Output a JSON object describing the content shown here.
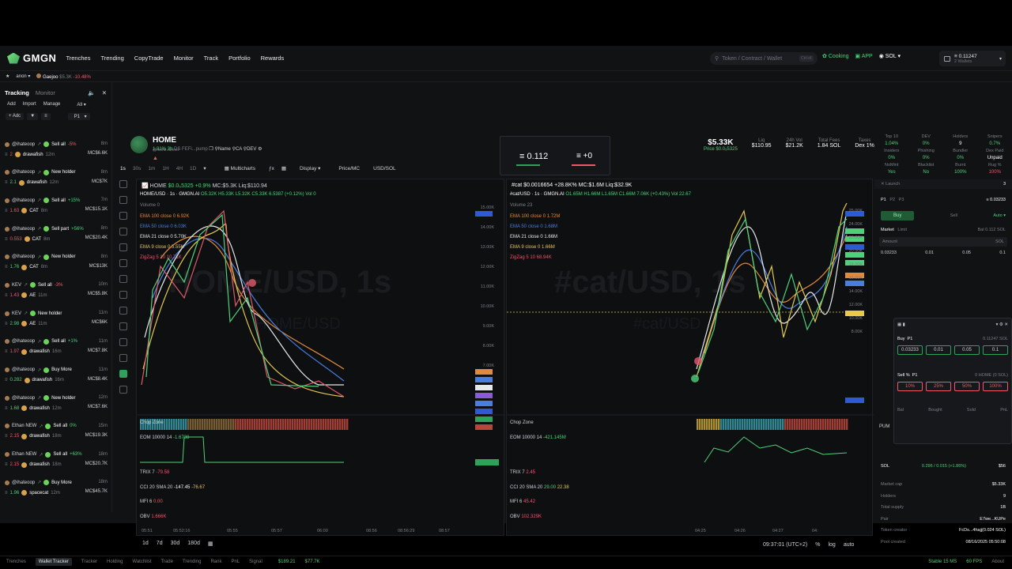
{
  "nav": {
    "brand": "GMGN",
    "links": [
      "Trenches",
      "Trending",
      "CopyTrade",
      "Monitor",
      "Track",
      "Portfolio",
      "Rewards"
    ],
    "search_placeholder": "Token / Contract / Wallet",
    "search_kbd": "Ctrl+K",
    "cooking": "Cooking",
    "app": "APP",
    "chain": "SOL",
    "wallet_balance": "0.11247",
    "wallet_count": "2 Wallets"
  },
  "subbar": {
    "account": "anon",
    "ticker_name": "Gaejoo",
    "ticker_mc": "$5.3K",
    "ticker_change": "-10.48%"
  },
  "left": {
    "tab_active": "Tracking",
    "tab_other": "Monitor",
    "actions": [
      "Add",
      "Import",
      "Manage"
    ],
    "filter_all": "All",
    "filter_add": "+ Adc",
    "filter_p1": "P1",
    "feed": [
      {
        "user": "@ihateoop",
        "action": "Sell all",
        "pct": "-5%",
        "time": "8m",
        "amt": "2",
        "token": "drawafish",
        "age": "12m",
        "mc": "MC$6.6K"
      },
      {
        "user": "@ihateoop",
        "action": "New holder",
        "pct": "",
        "time": "8m",
        "amt": "2.1",
        "token": "drawafish",
        "age": "12m",
        "mc": "MC$7K"
      },
      {
        "user": "@ihateoop",
        "action": "Sell all",
        "pct": "+15%",
        "time": "7m",
        "amt": "1.63",
        "token": "CAT",
        "age": "8m",
        "mc": "MC$15.1K"
      },
      {
        "user": "@ihateoop",
        "action": "Sell part",
        "pct": "+56%",
        "time": "8m",
        "amt": "0.553",
        "token": "CAT",
        "age": "8m",
        "mc": "MC$20.4K"
      },
      {
        "user": "@ihateoop",
        "action": "New holder",
        "pct": "",
        "time": "8m",
        "amt": "1.76",
        "token": "CAT",
        "age": "8m",
        "mc": "MC$13K"
      },
      {
        "user": "KEV",
        "action": "Sell all",
        "pct": "-3%",
        "time": "10m",
        "amt": "1.43",
        "token": "AE",
        "age": "11m",
        "mc": "MC$5.8K"
      },
      {
        "user": "KEV",
        "action": "New holder",
        "pct": "",
        "time": "11m",
        "amt": "2.98",
        "token": "AE",
        "age": "11m",
        "mc": "MC$6K"
      },
      {
        "user": "@ihateoop",
        "action": "Sell all",
        "pct": "+1%",
        "time": "11m",
        "amt": "1.97",
        "token": "drawafish",
        "age": "16m",
        "mc": "MC$7.8K"
      },
      {
        "user": "@ihateoop",
        "action": "Buy More",
        "pct": "",
        "time": "11m",
        "amt": "0.282",
        "token": "drawafish",
        "age": "16m",
        "mc": "MC$8.4K"
      },
      {
        "user": "@ihateoop",
        "action": "New holder",
        "pct": "",
        "time": "12m",
        "amt": "1.68",
        "token": "drawafish",
        "age": "12m",
        "mc": "MC$7.6K"
      },
      {
        "user": "Ethan NEW",
        "action": "Sell all",
        "pct": "0%",
        "time": "15m",
        "amt": "2.15",
        "token": "drawafish",
        "age": "18m",
        "mc": "MC$19.3K"
      },
      {
        "user": "Ethan NEW",
        "action": "Sell all",
        "pct": "+63%",
        "time": "18m",
        "amt": "2.15",
        "token": "drawafish",
        "age": "18m",
        "mc": "MC$20.7K"
      },
      {
        "user": "@ihateoop",
        "action": "Buy More",
        "pct": "",
        "time": "18m",
        "amt": "1.96",
        "token": "spacecat",
        "age": "12m",
        "mc": "MC$45.7K"
      }
    ]
  },
  "token": {
    "name": "HOME",
    "handle": "@home.runner",
    "change": "1.31%",
    "age": "3h",
    "pair": "DS FEFi...pump",
    "extras": [
      "Name",
      "CA",
      "DEV"
    ],
    "center_value": "0.112",
    "center_delta": "+0",
    "mc": "$5.33K",
    "price": "Price $0.0₅5325",
    "liq_label": "Liq",
    "liq": "$110.95",
    "vol_label": "24h Vol",
    "vol": "$21.2K",
    "fees_label": "Total Fees",
    "fees": "1.84 SOL",
    "taxes_label": "Taxes",
    "taxes": "Dex 1%"
  },
  "toolbar": {
    "intervals": [
      "1s",
      "30s",
      "1m",
      "1H",
      "4H",
      "1D"
    ],
    "multicharts": "Multicharts",
    "display": "Display",
    "price_mc": "Price/MC",
    "usd_sol": "USD/SOL"
  },
  "chart_left": {
    "title": "HOME/USD · 1s · GMGN.AI",
    "ohlc": "O5.32K H5.33K L5.32K C5.33K 6.5387 (+0.12%) Vol 0",
    "volume": "Volume 0",
    "watermark": "HOME/USD, 1s",
    "watermark_sub": "HOME/USD",
    "ema_lines": [
      "EMA 100 close 0  6.92K",
      "EMA 50 close 0  6.03K",
      "EMA 21 close 0  5.70K",
      "EMA 9 close 0  5.55K",
      "ZigZag 5 10  10.71K"
    ],
    "price_ticks": [
      "15.00K",
      "14.00K",
      "13.00K",
      "12.00K",
      "11.00K",
      "10.00K",
      "9.00K",
      "8.00K",
      "7.00K"
    ],
    "high_tag": "14.71K",
    "low_tag": "5.32K",
    "chop": "Chop Zone",
    "eom": "EOM 10000 14",
    "eom_val": "-1.6738",
    "trix": "TRIX 7",
    "trix_val": "-79.58",
    "cci": "CCI 20 SMA 20",
    "cci_val": "-147.45",
    "cci_val2": "-76.67",
    "mfi": "MFI 6",
    "mfi_val": "0.00",
    "obv": "OBV",
    "obv_val": "1.666K",
    "times": [
      "05:51",
      "05:52:16",
      "05:55",
      "05:57",
      "06:00",
      "08:56",
      "08:56:29",
      "08:57"
    ]
  },
  "chart_right": {
    "title": "#cat/USD · 1s · GMGN.AI",
    "pair_stats": "#cat $0.0016654 +28.8K%  MC:$1.6M  Liq:$32.9K",
    "ohlc": "O1.65M H1.66M L1.65M C1.66M 7.06K (+0.43%) Vol 22.67",
    "volume": "Volume 23",
    "watermark": "#cat/USD, 1s",
    "watermark_sub": "#cat/USD",
    "ema_lines": [
      "EMA 100 close 0  1.72M",
      "EMA 50 close 0  1.68M",
      "EMA 21 close 0  1.66M",
      "EMA 9 close 0  1.66M",
      "ZigZag 5 10  68.94K"
    ],
    "price_ticks": [
      "25.00K",
      "24.00K",
      "22.00K",
      "20.00K",
      "18.00K",
      "16.00K",
      "14.00K",
      "12.00K",
      "10.00K",
      "8.00K"
    ],
    "high_tag": "25.48K",
    "low_tag": "5.76K",
    "line_tag": "15.02K",
    "chop": "Chop Zone",
    "eom": "EOM 10000 14",
    "eom_val": "-421.145M",
    "trix": "TRIX 7",
    "trix_val": "2.45",
    "cci": "CCI 20 SMA 20",
    "cci_val": "29.00",
    "cci_val2": "22.38",
    "mfi": "MFI 6",
    "mfi_val": "45.42",
    "obv": "OBV",
    "obv_val": "102.329K",
    "times": [
      "04:25",
      "04:26",
      "04:27",
      "04:"
    ]
  },
  "bottom": {
    "ranges": [
      "1d",
      "7d",
      "30d",
      "180d"
    ],
    "clock": "09:37:01 (UTC+2)",
    "pct": "%",
    "log": "log",
    "auto": "auto"
  },
  "right": {
    "stats_labels": [
      "Top 10",
      "DEV",
      "Holders",
      "Snipers"
    ],
    "stats_values": [
      "1.04%",
      "0%",
      "9",
      "0.7%"
    ],
    "stats2_labels": [
      "Insiders",
      "Phishing",
      "Bundler",
      "Dex Paid"
    ],
    "stats2_values": [
      "0%",
      "0%",
      "0%",
      "Unpaid"
    ],
    "stats3_labels": [
      "NoMint",
      "Blacklist",
      "Burnt",
      "Rug %"
    ],
    "stats3_values": [
      "Yes",
      "No",
      "100%",
      "100%"
    ],
    "launch": "Launch",
    "launch_count": "3",
    "presets": [
      "P1",
      "P2",
      "P3"
    ],
    "buy": "Buy",
    "sell": "Sell",
    "auto": "Auto",
    "market": "Market",
    "limit": "Limit",
    "bal": "Bal 0.112 SOL",
    "amount": "Amount",
    "amount_unit": "SOL",
    "quick": [
      "0.03233",
      "0.01",
      "0.05",
      "0.1"
    ],
    "popup_quick": [
      "0.03233",
      "0.01",
      "0.05",
      "0.1"
    ],
    "sell_pct": [
      "10%",
      "25%",
      "50%",
      "100%"
    ],
    "popup_balance": "0.11247 SOL",
    "popup_home": "0 HOME (0 SOL)",
    "popup_sell_label": "Sell %",
    "popup_sell_preset": "P1",
    "popup_buy_label": "Buy",
    "popup_buy_preset": "P1",
    "popup_headers": [
      "Bal",
      "Bought",
      "Sold",
      "PnL"
    ],
    "pump": "PUM",
    "sol_label": "SOL",
    "sol_vals": "0.296 / 0.015 (+1.86%)",
    "sol_price": "$56",
    "info": [
      {
        "k": "Market cap",
        "v": "$5.33K"
      },
      {
        "k": "Holders",
        "v": "9"
      },
      {
        "k": "Total supply",
        "v": "1B"
      },
      {
        "k": "Pair",
        "v": "E7we...KUPe"
      },
      {
        "k": "Token creator",
        "v": "FcDs...4hajj(0.024 SOL)"
      },
      {
        "k": "Pool created",
        "v": "08/16/2025 05:50:08"
      }
    ]
  },
  "footer": {
    "items": [
      "Trenches",
      "Wallet Tracker",
      "Tracker",
      "Holding",
      "Watchlist",
      "Trade",
      "Trending",
      "Rank",
      "PnL",
      "Signal"
    ],
    "balance1": "$189.21",
    "balance2": "$77.7K",
    "status": "Stable 15 MS",
    "fps": "60 FPS",
    "about": "About"
  },
  "colors": {
    "bg": "#111214",
    "green": "#4fd17a",
    "red": "#f0586a",
    "accent": "#2ea25a"
  }
}
